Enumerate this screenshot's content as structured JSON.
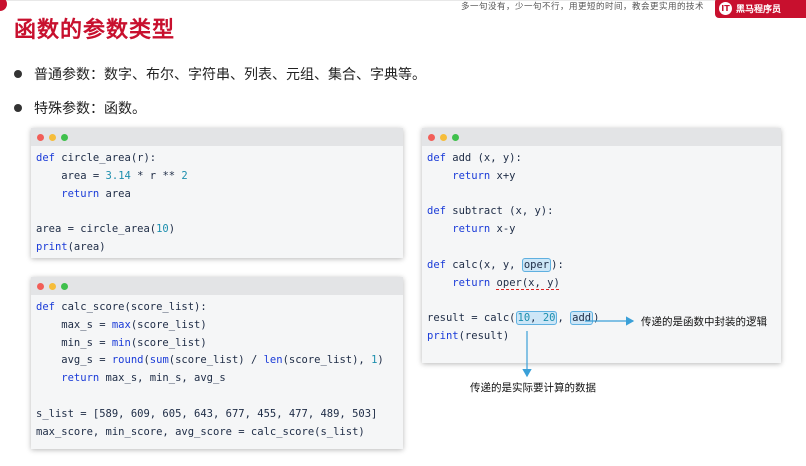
{
  "slide": {
    "title": "函数的参数类型",
    "slogan": "多一句没有，少一句不行，用更短的时间，教会更实用的技术",
    "brand": {
      "name": "黑马程序员",
      "logo_char": "IT"
    }
  },
  "bullets": [
    "普通参数：数字、布尔、字符串、列表、元组、集合、字典等。",
    "特殊参数：函数。"
  ],
  "code_window_1": {
    "lines": {
      "l1_def": "def",
      "l1_rest": " circle_area(r):",
      "l2_pre": "    area = ",
      "l2_num1": "3.14",
      "l2_mid": " * r ** ",
      "l2_num2": "2",
      "l3_kw": "    return",
      "l3_rest": " area",
      "l5_pre": "area = circle_area(",
      "l5_num": "10",
      "l5_post": ")",
      "l6_fn": "print",
      "l6_rest": "(area)"
    }
  },
  "code_window_2": {
    "lines": {
      "l1_def": "def",
      "l1_rest": " calc_score(score_list):",
      "l2_pre": "    max_s = ",
      "l2_fn": "max",
      "l2_rest": "(score_list)",
      "l3_pre": "    min_s = ",
      "l3_fn": "min",
      "l3_rest": "(score_list)",
      "l4_pre": "    avg_s = ",
      "l4_fn1": "round",
      "l4_p1": "(",
      "l4_fn2": "sum",
      "l4_p2": "(score_list) / ",
      "l4_fn3": "len",
      "l4_p3": "(score_list), ",
      "l4_num": "1",
      "l4_p4": ")",
      "l5_kw": "    return",
      "l5_rest": " max_s, min_s, avg_s",
      "l7": "s_list = [589, 609, 605, 643, 677, 455, 477, 489, 503]",
      "l8": "max_score, min_score, avg_score = calc_score(s_list)"
    }
  },
  "code_window_3": {
    "lines": {
      "l1_def": "def",
      "l1_rest": " add (x, y):",
      "l2_kw": "    return",
      "l2_rest": " x+y",
      "l4_def": "def",
      "l4_rest": " subtract (x, y):",
      "l5_kw": "    return",
      "l5_rest": " x-y",
      "l7_def": "def",
      "l7_pre": " calc(x, y, ",
      "l7_hl": "oper",
      "l7_post": "):",
      "l8_kw": "    return",
      "l8_sp": " ",
      "l8_call": "oper(x, y)",
      "l10_pre": "result = calc(",
      "l10_hl1_a": "10",
      "l10_hl1_b": ", ",
      "l10_hl1_c": "20",
      "l10_mid": ", ",
      "l10_hl2": "add",
      "l10_post": ")",
      "l11_fn": "print",
      "l11_rest": "(result)"
    }
  },
  "annotations": {
    "function_arg": "传递的是函数中封装的逻辑",
    "data_arg": "传递的是实际要计算的数据"
  },
  "colors": {
    "accent": "#c8102e",
    "keyword": "#1a3bd8",
    "number": "#1d8fae",
    "highlight_border": "#5fb0e0",
    "arrow": "#3aa0d8"
  }
}
